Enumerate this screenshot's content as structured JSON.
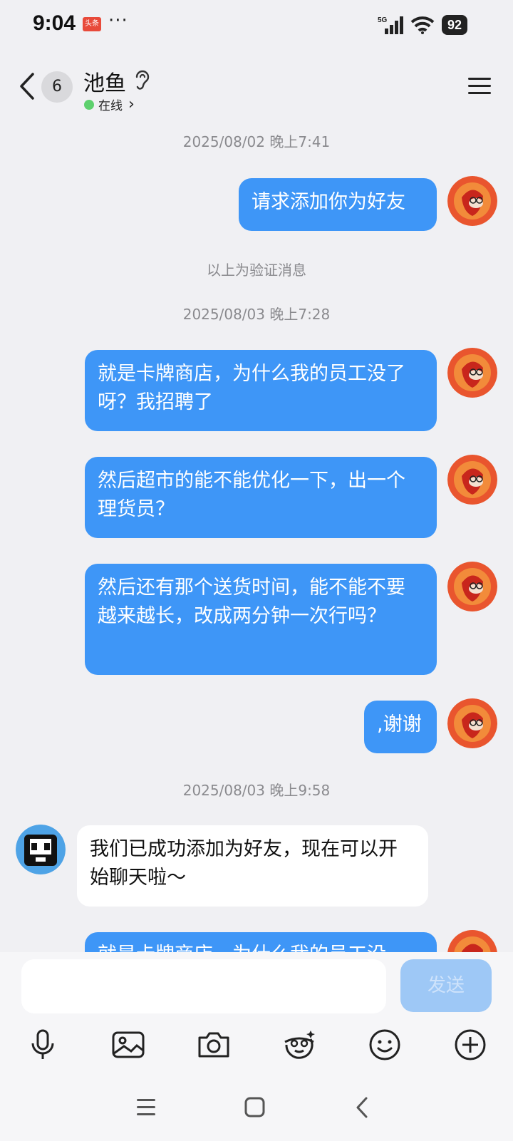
{
  "status_bar": {
    "time": "9:04",
    "news_badge": "头条",
    "more_dots": "···",
    "network": "5G",
    "battery": "92"
  },
  "header": {
    "unread_count": "6",
    "contact_name": "池鱼",
    "online_status": "在线",
    "online_chevron": "›"
  },
  "messages": [
    {
      "type": "timestamp",
      "text": "2025/08/02 晚上7:41"
    },
    {
      "type": "sent",
      "text": "请求添加你为好友"
    },
    {
      "type": "system",
      "text": "以上为验证消息"
    },
    {
      "type": "timestamp",
      "text": "2025/08/03 晚上7:28"
    },
    {
      "type": "sent",
      "text": "就是卡牌商店，为什么我的员工没了呀？我招聘了"
    },
    {
      "type": "sent",
      "text": "然后超市的能不能优化一下，出一个理货员？"
    },
    {
      "type": "sent",
      "text": "然后还有那个送货时间，能不能不要越来越长，改成两分钟一次行吗？"
    },
    {
      "type": "sent",
      "text": ",谢谢"
    },
    {
      "type": "timestamp",
      "text": "2025/08/03 晚上9:58"
    },
    {
      "type": "received",
      "text": "我们已成功添加为好友，现在可以开始聊天啦～"
    },
    {
      "type": "sent",
      "text": "就是卡牌商店，为什么我的员工没"
    }
  ],
  "input": {
    "placeholder": "",
    "send_label": "发送"
  },
  "toolbar": [
    "microphone-icon",
    "image-icon",
    "camera-icon",
    "sticker-face-icon",
    "emoji-icon",
    "plus-icon"
  ],
  "colors": {
    "sent_bubble": "#3e96f7",
    "received_bubble": "#ffffff",
    "background": "#f0f0f3",
    "online_dot": "#5dd06d",
    "send_disabled": "#9ec8f6"
  }
}
